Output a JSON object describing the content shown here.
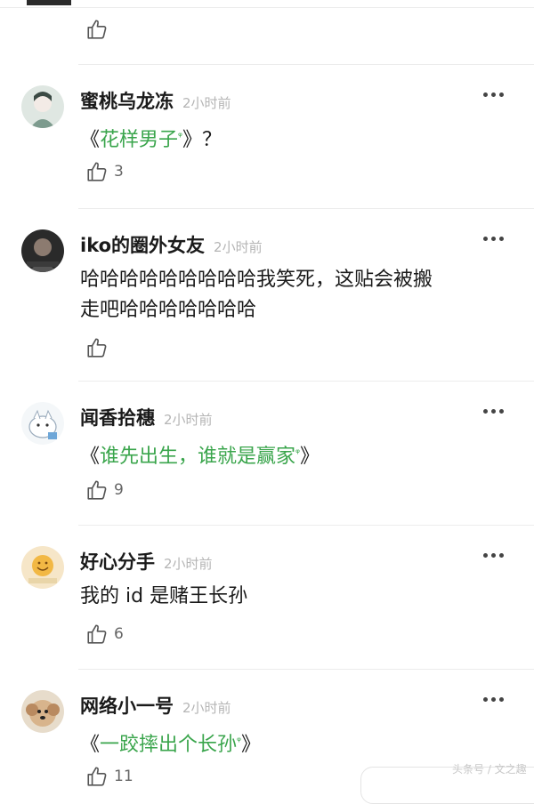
{
  "first_like": {
    "count": ""
  },
  "comments": [
    {
      "name": "蜜桃乌龙冻",
      "time": "2小时前",
      "text_parts": [
        "《",
        "花样男子",
        "》？"
      ],
      "likes": "3"
    },
    {
      "name": "iko的圈外女友",
      "time": "2小时前",
      "text_line1": "哈哈哈哈哈哈哈哈哈我笑死，这贴会被搬",
      "text_line2": "走吧哈哈哈哈哈哈哈",
      "likes": ""
    },
    {
      "name": "闻香拾穗",
      "time": "2小时前",
      "text_parts": [
        "《",
        "谁先出生，谁就是赢家",
        "》"
      ],
      "likes": "9"
    },
    {
      "name": "好心分手",
      "time": "2小时前",
      "text": "我的 id 是赌王长孙",
      "likes": "6"
    },
    {
      "name": "网络小一号",
      "time": "2小时前",
      "text_parts": [
        "《",
        "一跤摔出个长孙",
        "》"
      ],
      "likes": "11"
    }
  ],
  "watermark": "头条号 / 文之趣",
  "colors": {
    "link_green": "#3aa54c",
    "name": "#1a1a1a",
    "time": "#b5b5b5"
  }
}
